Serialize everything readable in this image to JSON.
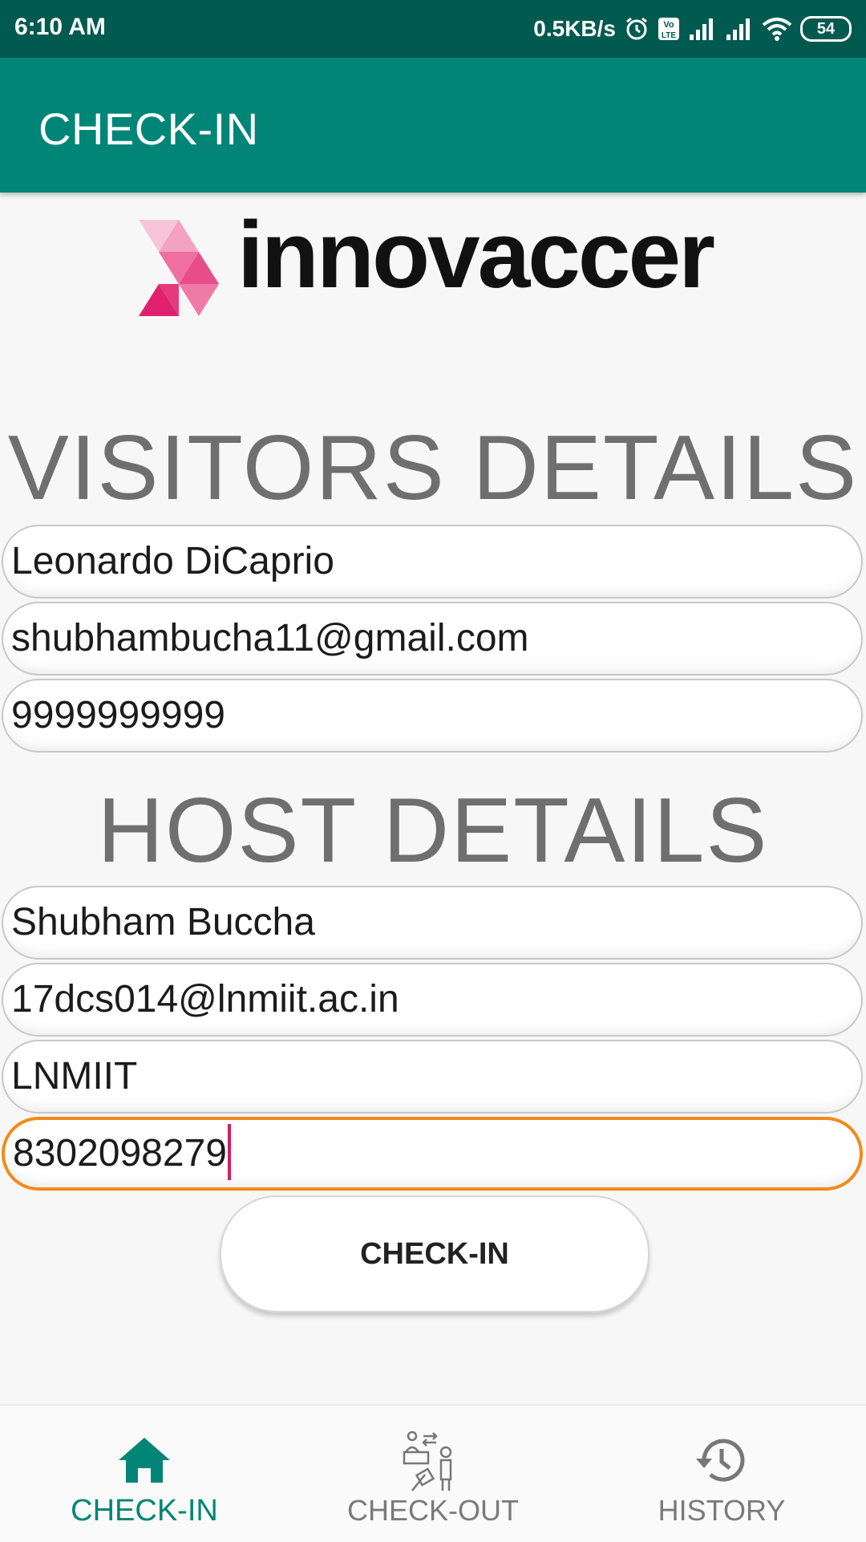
{
  "status_bar": {
    "time": "6:10 AM",
    "net_speed": "0.5KB/s",
    "battery": "54",
    "volte": "Vo LTE"
  },
  "app_bar": {
    "title": "CHECK-IN"
  },
  "logo": {
    "text": "innovaccer"
  },
  "visitor": {
    "heading": "VISITORS DETAILS",
    "name": "Leonardo DiCaprio",
    "email": "shubhambucha11@gmail.com",
    "phone": "9999999999"
  },
  "host": {
    "heading": "HOST DETAILS",
    "name": "Shubham Buccha",
    "email": "17dcs014@lnmiit.ac.in",
    "org": "LNMIIT",
    "phone": "8302098279"
  },
  "checkin_button": "CHECK-IN",
  "bottom_nav": {
    "items": [
      {
        "label": "CHECK-IN",
        "icon": "home-icon",
        "active": true
      },
      {
        "label": "CHECK-OUT",
        "icon": "check-out-icon",
        "active": false
      },
      {
        "label": "HISTORY",
        "icon": "history-icon",
        "active": false
      }
    ]
  },
  "colors": {
    "primary": "#008577",
    "primary_dark": "#005a4f",
    "focus": "#f28a1b",
    "cursor": "#d81b60"
  }
}
